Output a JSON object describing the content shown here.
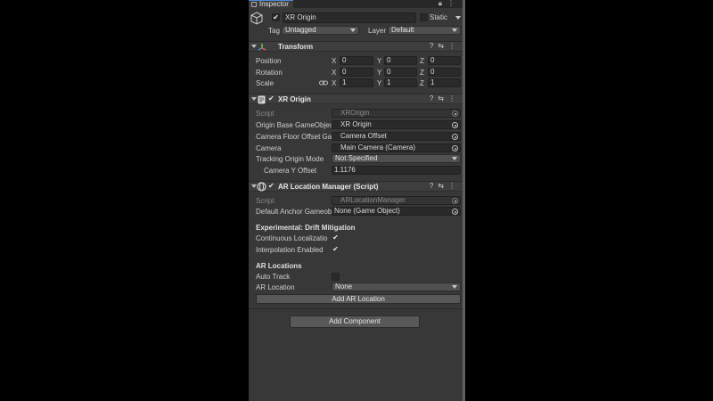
{
  "tab": {
    "label": "Inspector"
  },
  "object": {
    "name": "XR Origin",
    "static_label": "Static",
    "tag_label": "Tag",
    "tag_value": "Untagged",
    "layer_label": "Layer",
    "layer_value": "Default"
  },
  "transform": {
    "title": "Transform",
    "position_label": "Position",
    "rotation_label": "Rotation",
    "scale_label": "Scale",
    "axes": [
      "X",
      "Y",
      "Z"
    ],
    "position": [
      "0",
      "0",
      "0"
    ],
    "rotation": [
      "0",
      "0",
      "0"
    ],
    "scale": [
      "1",
      "1",
      "1"
    ]
  },
  "xr_origin": {
    "title": "XR Origin",
    "script_label": "Script",
    "script_value": "XROrigin",
    "origin_base_label": "Origin Base GameObjec",
    "origin_base_value": "XR Origin",
    "camera_floor_label": "Camera Floor Offset Ga",
    "camera_floor_value": "Camera Offset",
    "camera_label": "Camera",
    "camera_value": "Main Camera (Camera)",
    "tracking_label": "Tracking Origin Mode",
    "tracking_value": "Not Specified",
    "camera_y_label": "Camera Y Offset",
    "camera_y_value": "1.1176"
  },
  "ar_location_manager": {
    "title": "AR Location Manager (Script)",
    "script_label": "Script",
    "script_value": "ARLocationManager",
    "default_anchor_label": "Default Anchor Gameob",
    "default_anchor_value": "None (Game Object)",
    "drift_title": "Experimental: Drift Mitigation",
    "continuous_label": "Continuous Localizatio",
    "interpolation_label": "Interpolation Enabled",
    "ar_locations_title": "AR Locations",
    "auto_track_label": "Auto Track",
    "ar_location_label": "AR Location",
    "ar_location_value": "None",
    "add_button": "Add AR Location"
  },
  "add_component": "Add Component",
  "glyphs": {
    "check": "✔",
    "lock": "🔒",
    "menu": "⋮",
    "help": "?",
    "preset": "⇆"
  },
  "colors": {
    "panel": "#383838",
    "header": "#3e3e3e",
    "field": "#2a2a2a",
    "button": "#585858",
    "accent": "#4a8ad6"
  }
}
